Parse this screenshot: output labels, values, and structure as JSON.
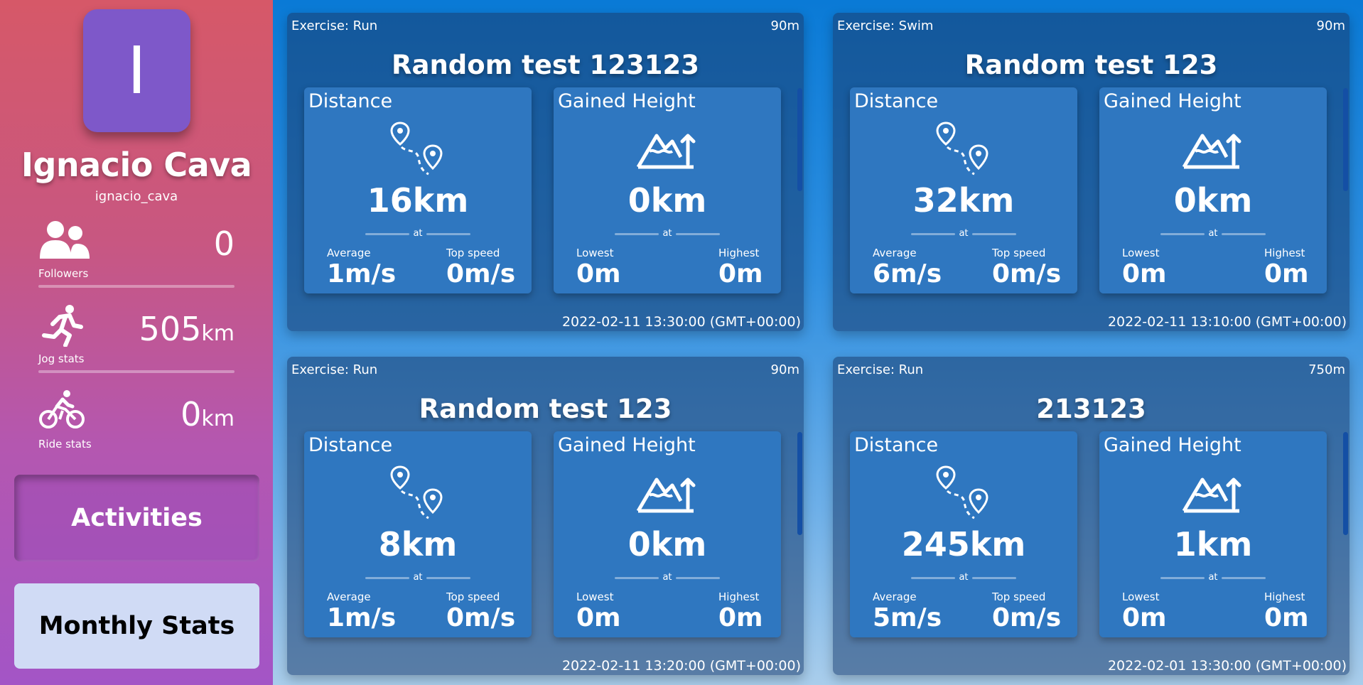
{
  "profile": {
    "avatar_letter": "I",
    "name": "Ignacio Cava",
    "username": "ignacio_cava"
  },
  "stats": [
    {
      "value": "0",
      "unit": "",
      "label": "Followers",
      "icon": "followers-icon"
    },
    {
      "value": "505",
      "unit": "km",
      "label": "Jog stats",
      "icon": "runner-icon"
    },
    {
      "value": "0",
      "unit": "km",
      "label": "Ride stats",
      "icon": "cyclist-icon"
    }
  ],
  "nav": {
    "activities": "Activities",
    "monthly_stats": "Monthly Stats"
  },
  "activities": [
    {
      "exercise": "Exercise: Run",
      "duration": "90m",
      "title": "Random test 123123",
      "distance": {
        "title": "Distance",
        "value": "16km",
        "at": "at",
        "left_label": "Average",
        "left_value": "1m/s",
        "right_label": "Top speed",
        "right_value": "0m/s"
      },
      "height": {
        "title": "Gained Height",
        "value": "0km",
        "at": "at",
        "left_label": "Lowest",
        "left_value": "0m",
        "right_label": "Highest",
        "right_value": "0m"
      },
      "date": "2022-02-11 13:30:00 (GMT+00:00)"
    },
    {
      "exercise": "Exercise: Swim",
      "duration": "90m",
      "title": "Random test 123",
      "distance": {
        "title": "Distance",
        "value": "32km",
        "at": "at",
        "left_label": "Average",
        "left_value": "6m/s",
        "right_label": "Top speed",
        "right_value": "0m/s"
      },
      "height": {
        "title": "Gained Height",
        "value": "0km",
        "at": "at",
        "left_label": "Lowest",
        "left_value": "0m",
        "right_label": "Highest",
        "right_value": "0m"
      },
      "date": "2022-02-11 13:10:00 (GMT+00:00)"
    },
    {
      "exercise": "Exercise: Run",
      "duration": "90m",
      "title": "Random test 123",
      "distance": {
        "title": "Distance",
        "value": "8km",
        "at": "at",
        "left_label": "Average",
        "left_value": "1m/s",
        "right_label": "Top speed",
        "right_value": "0m/s"
      },
      "height": {
        "title": "Gained Height",
        "value": "0km",
        "at": "at",
        "left_label": "Lowest",
        "left_value": "0m",
        "right_label": "Highest",
        "right_value": "0m"
      },
      "date": "2022-02-11 13:20:00 (GMT+00:00)"
    },
    {
      "exercise": "Exercise: Run",
      "duration": "750m",
      "title": "213123",
      "distance": {
        "title": "Distance",
        "value": "245km",
        "at": "at",
        "left_label": "Average",
        "left_value": "5m/s",
        "right_label": "Top speed",
        "right_value": "0m/s"
      },
      "height": {
        "title": "Gained Height",
        "value": "1km",
        "at": "at",
        "left_label": "Lowest",
        "left_value": "0m",
        "right_label": "Highest",
        "right_value": "0m"
      },
      "date": "2022-02-01 13:30:00 (GMT+00:00)"
    }
  ],
  "colors": {
    "sidebar_top": "#d65868",
    "sidebar_bottom": "#a355c6",
    "avatar_bg": "#7e58c9",
    "panel_bg": "#2f77c0",
    "monthly_btn_bg": "#d0dbf5"
  }
}
